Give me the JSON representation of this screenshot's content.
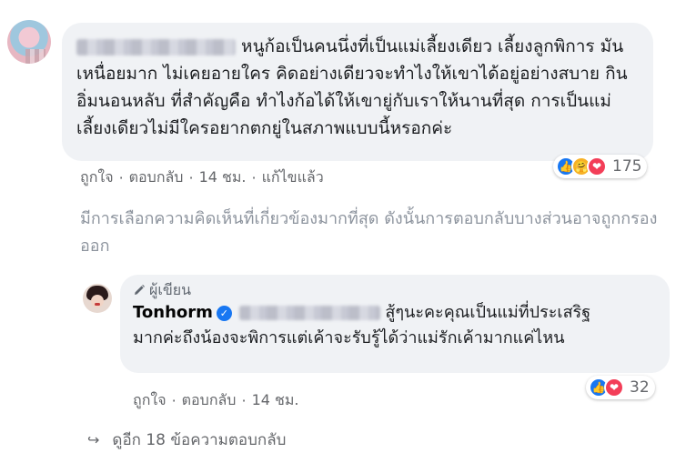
{
  "main_comment": {
    "text": "หนูก้อเป็นคนนึ่งที่เป็นแม่เลี้ยงเดียว เลี้ยงลูกพิการ มันเหนื่อยมาก ไม่เคยอายใคร คิดอย่างเดียวจะทำไงให้เขาได้อยู่อย่างสบาย กินอิ่มนอนหลับ ที่สำคัญคือ ทำไงก้อได้ให้เขายู่กับเราให้นานที่สุด การเป็นแม่เลี้ยงเดียวไม่มีใครอยากตกยู่ในสภาพแบบนี้หรอกค่ะ",
    "actions": {
      "like": "ถูกใจ",
      "reply": "ตอบกลับ",
      "time": "14 ชม.",
      "edited": "แก้ไขแล้ว"
    },
    "reaction_count": "175"
  },
  "notice": "มีการเลือกความคิดเห็นที่เกี่ยวข้องมากที่สุด ดังนั้นการตอบกลับบางส่วนอาจถูกกรองออก",
  "reply": {
    "author_tag": "ผู้เขียน",
    "name": "Tonhorm",
    "text_first": "สู้ๆนะคะคุณเป็นแม่ที่ประเสริฐ",
    "text_rest": "มากค่ะถึงน้องจะพิการแต่เค้าจะรับรู้ได้ว่าแม่รักเค้ามากแค่ไหน",
    "actions": {
      "like": "ถูกใจ",
      "reply": "ตอบกลับ",
      "time": "14 ชม."
    },
    "reaction_count": "32"
  },
  "more_replies": "ดูอีก 18 ข้อความตอบกลับ",
  "colors": {
    "bubble": "#f0f2f5",
    "meta_text": "#65676b",
    "notice_text": "#8d949e",
    "like_blue": "#1877f2",
    "love_red": "#f33e58",
    "care_yellow": "#f7b125"
  }
}
